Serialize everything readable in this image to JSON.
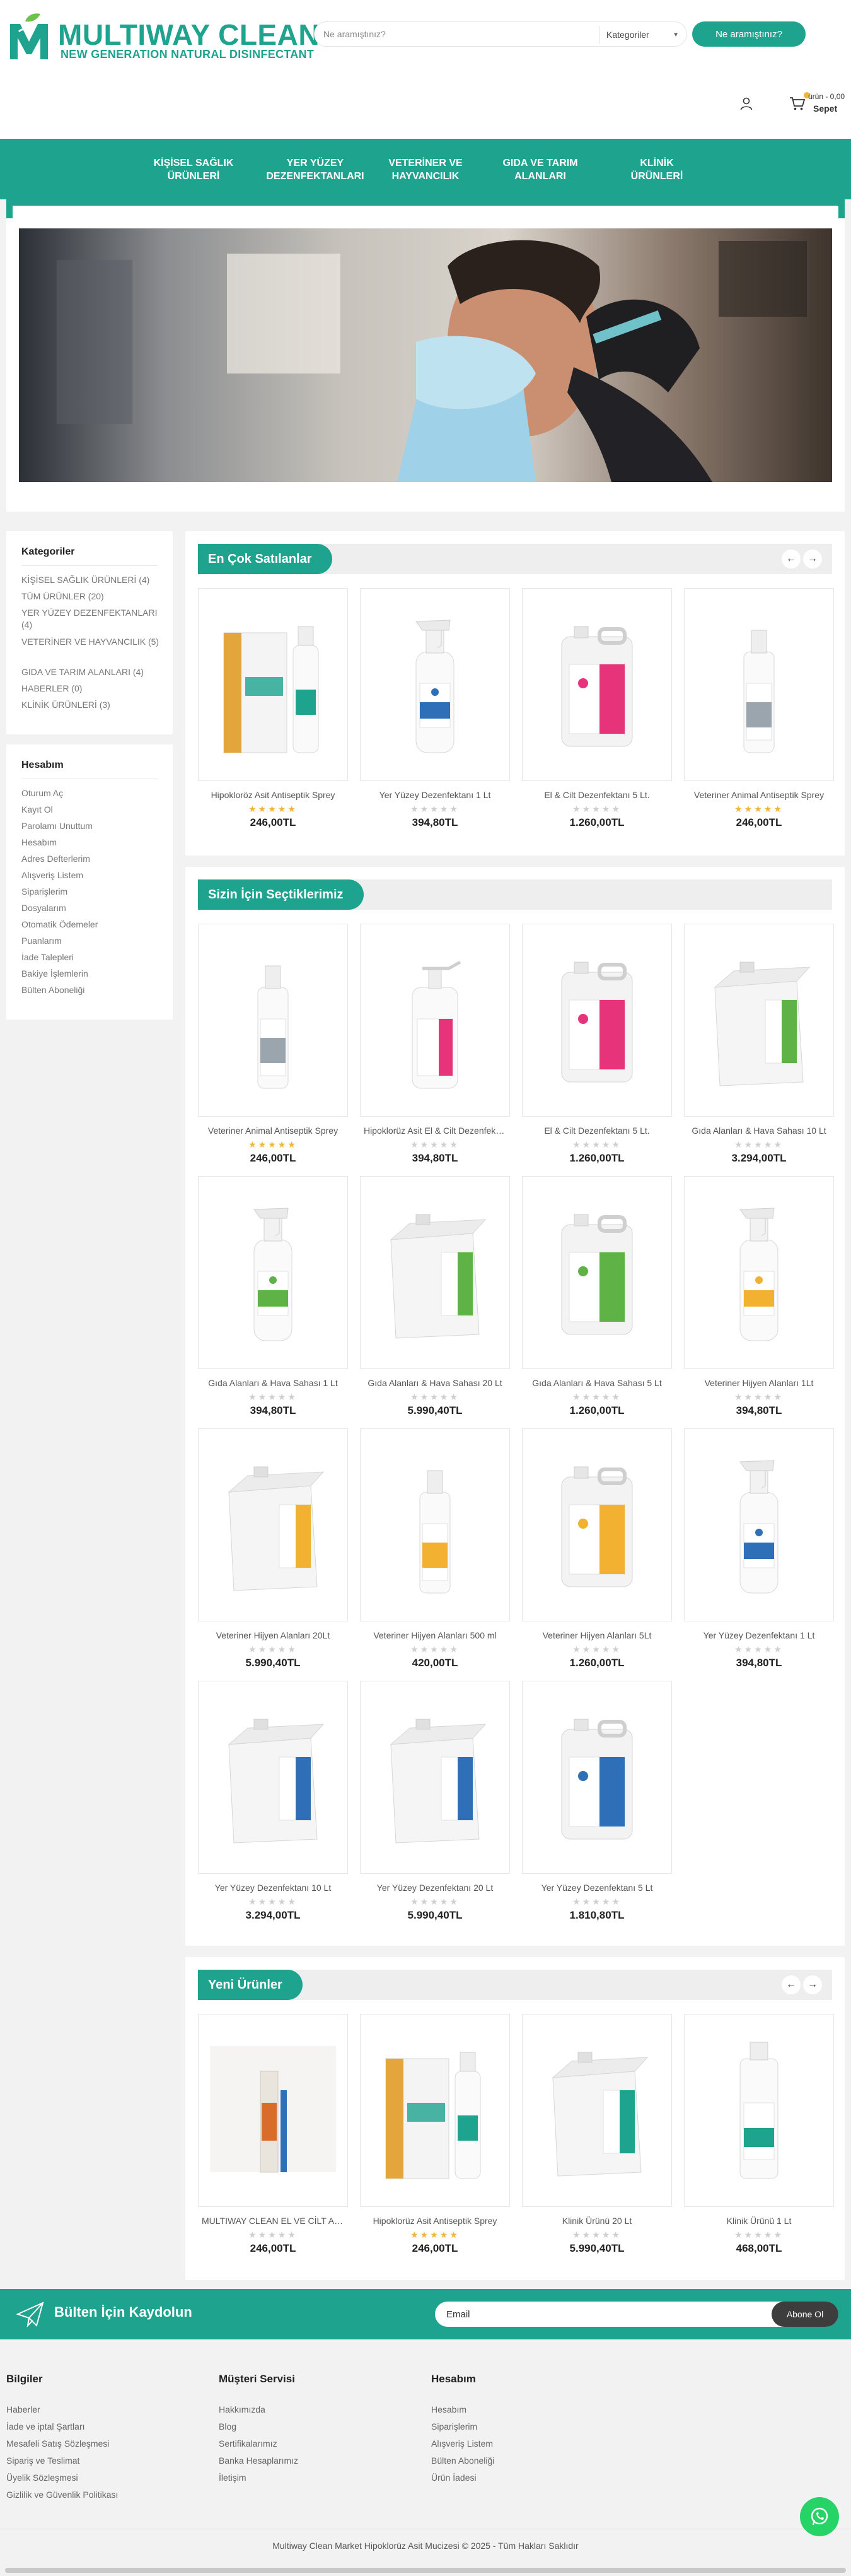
{
  "brand": {
    "name": "MULTIWAY CLEAN",
    "tagline": "NEW GENERATION NATURAL DISINFECTANT",
    "color": "#1ea38e"
  },
  "search": {
    "placeholder": "Ne aramıştınız?",
    "category_label": "Kategoriler",
    "button_label": "Ne aramıştınız?"
  },
  "cart": {
    "summary": "ürün - 0,00",
    "label": "Sepet"
  },
  "nav": [
    {
      "line1": "KİŞİSEL SAĞLIK",
      "line2": "ÜRÜNLERİ"
    },
    {
      "line1": "YER YÜZEY",
      "line2": "DEZENFEKTANLARI"
    },
    {
      "line1": "VETERİNER VE",
      "line2": "HAYVANCILIK"
    },
    {
      "line1": "GIDA VE TARIM",
      "line2": "ALANLARI"
    },
    {
      "line1": "KLİNİK",
      "line2": "ÜRÜNLERİ"
    }
  ],
  "categories": {
    "title": "Kategoriler",
    "items": [
      "KİŞİSEL SAĞLIK ÜRÜNLERİ (4)",
      "TÜM ÜRÜNLER (20)",
      "YER YÜZEY DEZENFEKTANLARI (4)",
      "VETERİNER VE HAYVANCILIK (5)",
      "GIDA VE TARIM ALANLARI (4)",
      "HABERLER (0)",
      "KLİNİK ÜRÜNLERİ (3)"
    ]
  },
  "account": {
    "title": "Hesabım",
    "items": [
      "Oturum Aç",
      "Kayıt Ol",
      "Parolamı Unuttum",
      "Hesabım",
      "Adres Defterlerim",
      "Alışveriş Listem",
      "Siparişlerim",
      "Dosyalarım",
      "Otomatik Ödemeler",
      "Puanlarım",
      "İade Talepleri",
      "Bakiye İşlemlerin",
      "Bülten Aboneliği"
    ]
  },
  "bestsellers": {
    "title": "En Çok Satılanlar",
    "products": [
      {
        "name": "Hipokloröz Asit Antiseptik Sprey",
        "price": "246,00TL",
        "rating": 5,
        "kind": "box",
        "color": "#1ea38e"
      },
      {
        "name": "Yer Yüzey Dezenfektanı 1 Lt",
        "price": "394,80TL",
        "rating": 0,
        "kind": "spray",
        "color": "#2e6fb8"
      },
      {
        "name": "El & Cilt Dezenfektanı 5 Lt.",
        "price": "1.260,00TL",
        "rating": 0,
        "kind": "jerry",
        "color": "#e6337a"
      },
      {
        "name": "Veteriner Animal Antiseptik Sprey",
        "price": "246,00TL",
        "rating": 5,
        "kind": "bottle",
        "color": "#9aa5ad"
      }
    ]
  },
  "picks": {
    "title": "Sizin İçin Seçtiklerimiz",
    "products": [
      {
        "name": "Veteriner Animal Antiseptik Sprey",
        "price": "246,00TL",
        "rating": 5,
        "kind": "bottle",
        "color": "#9aa5ad"
      },
      {
        "name": "Hipoklorüz Asit El & Cilt Dezenfektanı",
        "price": "394,80TL",
        "rating": 0,
        "kind": "pump",
        "color": "#e6337a"
      },
      {
        "name": "El & Cilt Dezenfektanı 5 Lt.",
        "price": "1.260,00TL",
        "rating": 0,
        "kind": "jerry",
        "color": "#e6337a"
      },
      {
        "name": "Gıda Alanları & Hava Sahası 10 Lt",
        "price": "3.294,00TL",
        "rating": 0,
        "kind": "bigjerry",
        "color": "#5fb346"
      },
      {
        "name": "Gıda Alanları & Hava Sahası 1 Lt",
        "price": "394,80TL",
        "rating": 0,
        "kind": "spray",
        "color": "#5fb346"
      },
      {
        "name": "Gıda Alanları & Hava Sahası 20 Lt",
        "price": "5.990,40TL",
        "rating": 0,
        "kind": "bigjerry",
        "color": "#5fb346"
      },
      {
        "name": "Gıda Alanları & Hava Sahası 5 Lt",
        "price": "1.260,00TL",
        "rating": 0,
        "kind": "jerry",
        "color": "#5fb346"
      },
      {
        "name": "Veteriner Hijyen Alanları 1Lt",
        "price": "394,80TL",
        "rating": 0,
        "kind": "spray",
        "color": "#f2b131"
      },
      {
        "name": "Veteriner Hijyen Alanları 20Lt",
        "price": "5.990,40TL",
        "rating": 0,
        "kind": "bigjerry",
        "color": "#f2b131"
      },
      {
        "name": "Veteriner Hijyen Alanları 500 ml",
        "price": "420,00TL",
        "rating": 0,
        "kind": "bottle",
        "color": "#f2b131"
      },
      {
        "name": "Veteriner Hijyen Alanları 5Lt",
        "price": "1.260,00TL",
        "rating": 0,
        "kind": "jerry",
        "color": "#f2b131"
      },
      {
        "name": "Yer Yüzey Dezenfektanı 1 Lt",
        "price": "394,80TL",
        "rating": 0,
        "kind": "spray",
        "color": "#2e6fb8"
      },
      {
        "name": "Yer Yüzey Dezenfektanı 10 Lt",
        "price": "3.294,00TL",
        "rating": 0,
        "kind": "bigjerry",
        "color": "#2e6fb8"
      },
      {
        "name": "Yer Yüzey Dezenfektanı 20 Lt",
        "price": "5.990,40TL",
        "rating": 0,
        "kind": "bigjerry",
        "color": "#2e6fb8"
      },
      {
        "name": "Yer Yüzey Dezenfektanı 5 Lt",
        "price": "1.810,80TL",
        "rating": 0,
        "kind": "jerry",
        "color": "#2e6fb8"
      }
    ]
  },
  "newest": {
    "title": "Yeni Ürünler",
    "products": [
      {
        "name": "MULTIWAY CLEAN EL VE CİLT ANTİSEPTİĞİ",
        "price": "246,00TL",
        "rating": 0,
        "kind": "tube",
        "color": "#d96b2b"
      },
      {
        "name": "Hipoklorüz Asit Antiseptik Sprey",
        "price": "246,00TL",
        "rating": 5,
        "kind": "box",
        "color": "#1ea38e"
      },
      {
        "name": "Klinik Ürünü 20 Lt",
        "price": "5.990,40TL",
        "rating": 0,
        "kind": "bigjerry",
        "color": "#1ea38e"
      },
      {
        "name": "Klinik Ürünü 1 Lt",
        "price": "468,00TL",
        "rating": 0,
        "kind": "tallbottle",
        "color": "#1ea38e"
      }
    ]
  },
  "newsletter": {
    "title": "Bülten İçin Kaydolun",
    "placeholder": "Email",
    "button": "Abone Ol"
  },
  "footer": {
    "columns": [
      {
        "title": "Bilgiler",
        "links": [
          "Haberler",
          "İade ve iptal Şartları",
          "Mesafeli Satış Sözleşmesi",
          "Sipariş ve Teslimat",
          "Üyelik Sözleşmesi",
          "Gizlilik ve Güvenlik Politikası"
        ]
      },
      {
        "title": "Müşteri Servisi",
        "links": [
          "Hakkımızda",
          "Blog",
          "Sertifikalarımız",
          "Banka Hesaplarımız",
          "İletişim"
        ]
      },
      {
        "title": "Hesabım",
        "links": [
          "Hesabım",
          "Siparişlerim",
          "Alışveriş Listem",
          "Bülten Aboneliği",
          "Ürün İadesi"
        ]
      }
    ],
    "copyright": "Multiway Clean Market Hipoklorüz Asit Mucizesi © 2025 - Tüm Hakları Saklıdır"
  }
}
